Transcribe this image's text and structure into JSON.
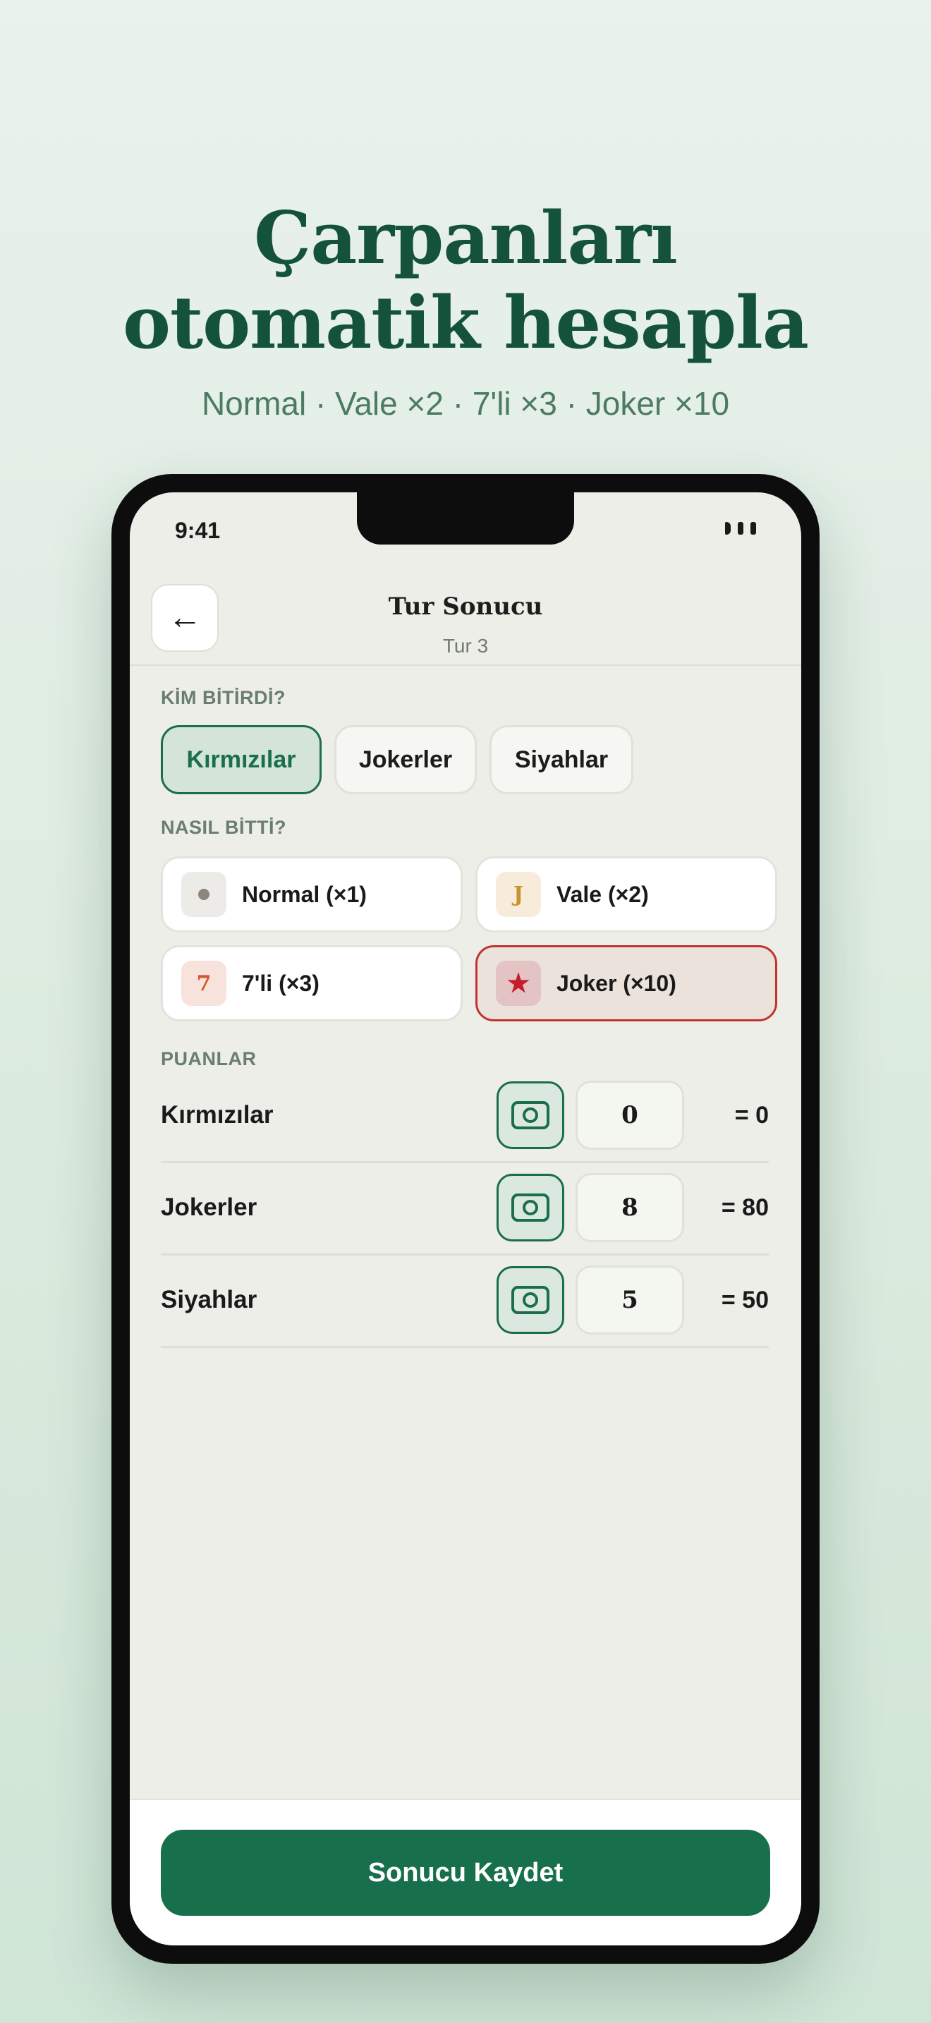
{
  "hero": {
    "title_line1": "Çarpanları",
    "title_line2": "otomatik hesapla",
    "subtitle": "Normal · Vale ×2 · 7'li ×3 · Joker ×10"
  },
  "status_bar": {
    "time": "9:41"
  },
  "nav": {
    "back_icon": "←",
    "title": "Tur Sonucu",
    "subtitle": "Tur 3"
  },
  "winner_section": {
    "label": "KİM BİTİRDİ?",
    "options": [
      "Kırmızılar",
      "Jokerler",
      "Siyahlar"
    ],
    "selected": "Kırmızılar"
  },
  "finish_section": {
    "label": "NASIL BİTTİ?",
    "options": [
      {
        "badge": "",
        "label": "Normal (×1)",
        "icon": "dot-icon"
      },
      {
        "badge": "J",
        "label": "Vale (×2)",
        "icon": "jack-icon"
      },
      {
        "badge": "7",
        "label": "7'li (×3)",
        "icon": "seven-icon"
      },
      {
        "badge": "★",
        "label": "Joker (×10)",
        "icon": "star-icon"
      }
    ],
    "selected": "Joker (×10)"
  },
  "scores_section": {
    "label": "PUANLAR",
    "rows": [
      {
        "team": "Kırmızılar",
        "value": "0",
        "total": "= 0"
      },
      {
        "team": "Jokerler",
        "value": "8",
        "total": "= 80"
      },
      {
        "team": "Siyahlar",
        "value": "5",
        "total": "= 50"
      }
    ]
  },
  "save_button": {
    "label": "Sonucu Kaydet"
  },
  "colors": {
    "brand_green": "#17704b",
    "title_green": "#14533a",
    "joker_red": "#c23330"
  }
}
